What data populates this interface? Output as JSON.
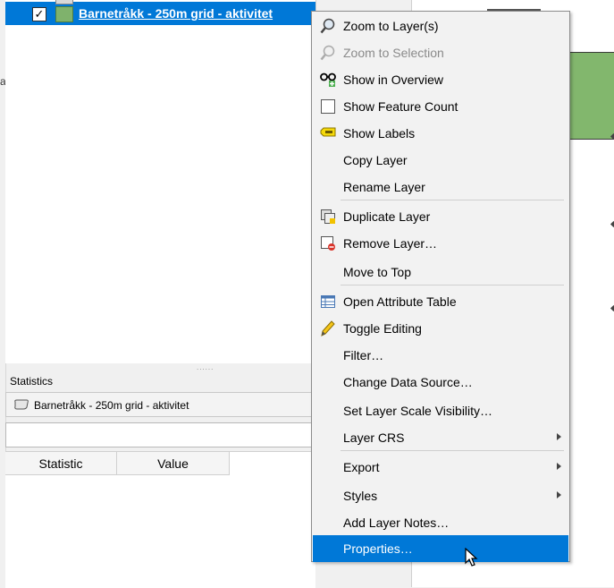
{
  "left_edge_fragment": "a",
  "layers_panel": {
    "selected_layer": {
      "checked": "✓",
      "name": "Barnetråkk - 250m grid - aktivitet"
    },
    "splitter": "......"
  },
  "statistics_panel": {
    "title": "Statistics",
    "layer_combo": "Barnetråkk - 250m grid - aktivitet",
    "field_input_value": "",
    "columns": [
      "Statistic",
      "Value"
    ]
  },
  "context_menu": {
    "items": [
      {
        "label": "Zoom to Layer(s)",
        "icon": "zoom-icon"
      },
      {
        "label": "Zoom to Selection",
        "icon": "zoom-selection-icon",
        "disabled": true
      },
      {
        "label": "Show in Overview",
        "icon": "overview-icon"
      },
      {
        "label": "Show Feature Count",
        "icon": "checkbox-icon"
      },
      {
        "label": "Show Labels",
        "icon": "labels-icon"
      },
      {
        "label": "Copy Layer"
      },
      {
        "label": "Rename Layer"
      },
      {
        "label": "Duplicate Layer",
        "icon": "duplicate-icon"
      },
      {
        "label": "Remove Layer…",
        "icon": "remove-icon"
      },
      {
        "label": "Move to Top"
      },
      {
        "label": "Open Attribute Table",
        "icon": "table-icon"
      },
      {
        "label": "Toggle Editing",
        "icon": "pencil-icon"
      },
      {
        "label": "Filter…"
      },
      {
        "label": "Change Data Source…"
      },
      {
        "label": "Set Layer Scale Visibility…"
      },
      {
        "label": "Layer CRS",
        "submenu": true
      },
      {
        "label": "Export",
        "submenu": true
      },
      {
        "label": "Styles",
        "submenu": true
      },
      {
        "label": "Add Layer Notes…"
      },
      {
        "label": "Properties…",
        "selected": true
      }
    ]
  },
  "colors": {
    "selection": "#0078d7",
    "layer_fill": "#7fb26c"
  }
}
